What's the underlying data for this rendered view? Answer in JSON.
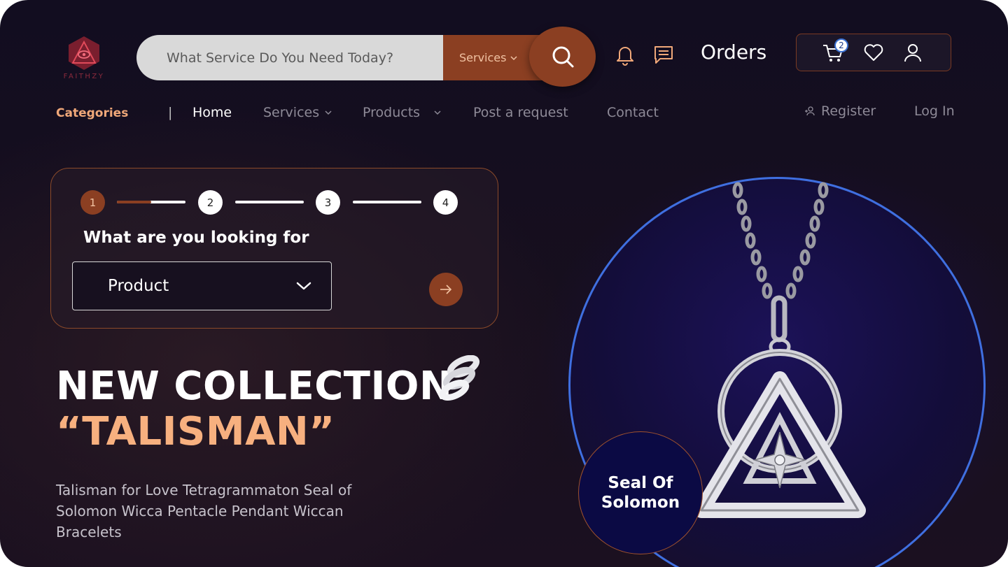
{
  "brand": {
    "logo_text": "FAITHZY"
  },
  "search": {
    "placeholder": "What Service Do You Need Today?",
    "category_label": "Services"
  },
  "header": {
    "orders_label": "Orders",
    "cart_count": "2"
  },
  "nav": {
    "categories_label": "Categories",
    "separator": "|",
    "items": [
      {
        "label": "Home"
      },
      {
        "label": "Services"
      },
      {
        "label": "Products"
      },
      {
        "label": "Post a request"
      },
      {
        "label": "Contact"
      }
    ],
    "register_label": "Register",
    "login_label": "Log In"
  },
  "stepper": {
    "steps": [
      "1",
      "2",
      "3",
      "4"
    ],
    "active_step": 1,
    "first_segment_progress": 0.5,
    "title": "What are you looking for",
    "select_value": "Product"
  },
  "hero": {
    "line1": "NEW COLLECTION",
    "line2": "“TALISMAN”",
    "description": "Talisman for Love Tetragrammaton Seal of Solomon Wicca Pentacle Pendant Wiccan Bracelets"
  },
  "product": {
    "badge_label": "Seal Of Solomon"
  },
  "colors": {
    "accent": "#8b3f22",
    "peach": "#f7b07f",
    "circle_ring": "#3f6fe0",
    "background": "#140e20"
  },
  "icons": [
    "logo-icon",
    "search-icon",
    "bell-icon",
    "message-icon",
    "cart-icon",
    "heart-icon",
    "user-icon",
    "chevron-down-icon",
    "user-plus-icon",
    "arrow-right-icon",
    "spring-icon"
  ]
}
